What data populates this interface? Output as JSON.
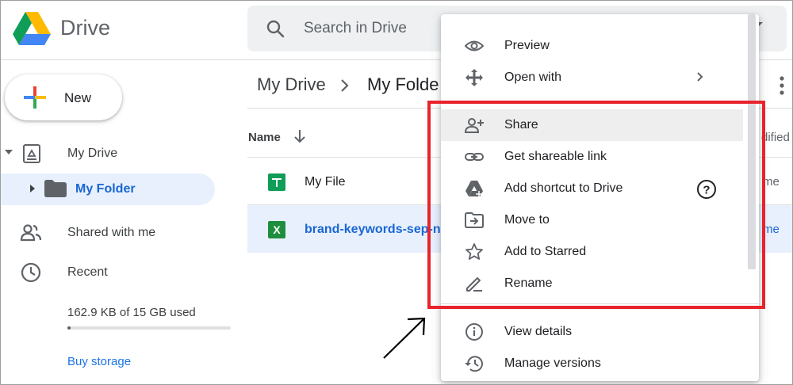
{
  "app": {
    "title": "Drive"
  },
  "search": {
    "placeholder": "Search in Drive"
  },
  "new_button": {
    "label": "New"
  },
  "sidebar": {
    "items": [
      {
        "label": "My Drive"
      },
      {
        "label": "My Folder"
      },
      {
        "label": "Shared with me"
      },
      {
        "label": "Recent"
      }
    ],
    "storage": {
      "text": "162.9 KB of 15 GB used",
      "used_fraction": 0.02
    },
    "buy_storage": "Buy storage"
  },
  "breadcrumb": {
    "root": "My Drive",
    "current": "My Folde"
  },
  "file_list": {
    "columns": {
      "name": "Name",
      "last_modified": "dified"
    },
    "rows": [
      {
        "name": "My File",
        "owner": "me",
        "type": "sheets"
      },
      {
        "name": "brand-keywords-sep-no",
        "owner": "me",
        "type": "excel",
        "selected": true
      }
    ]
  },
  "context_menu": {
    "items": [
      {
        "label": "Preview",
        "icon": "eye-icon"
      },
      {
        "label": "Open with",
        "icon": "open-with-icon",
        "submenu": true
      },
      {
        "label": "Share",
        "icon": "add-person-icon",
        "highlighted": true
      },
      {
        "label": "Get shareable link",
        "icon": "link-icon"
      },
      {
        "label": "Add shortcut to Drive",
        "icon": "drive-shortcut-icon",
        "help": true
      },
      {
        "label": "Move to",
        "icon": "move-to-icon"
      },
      {
        "label": "Add to Starred",
        "icon": "star-icon"
      },
      {
        "label": "Rename",
        "icon": "pencil-icon"
      },
      {
        "label": "View details",
        "icon": "info-icon"
      },
      {
        "label": "Manage versions",
        "icon": "history-icon"
      }
    ]
  },
  "colors": {
    "accent": "#1a73e8",
    "selected_bg": "#e8f0fe",
    "highlight_box": "#e8232c",
    "sheets_green": "#0f9d58",
    "excel_green": "#1e8e3e"
  }
}
